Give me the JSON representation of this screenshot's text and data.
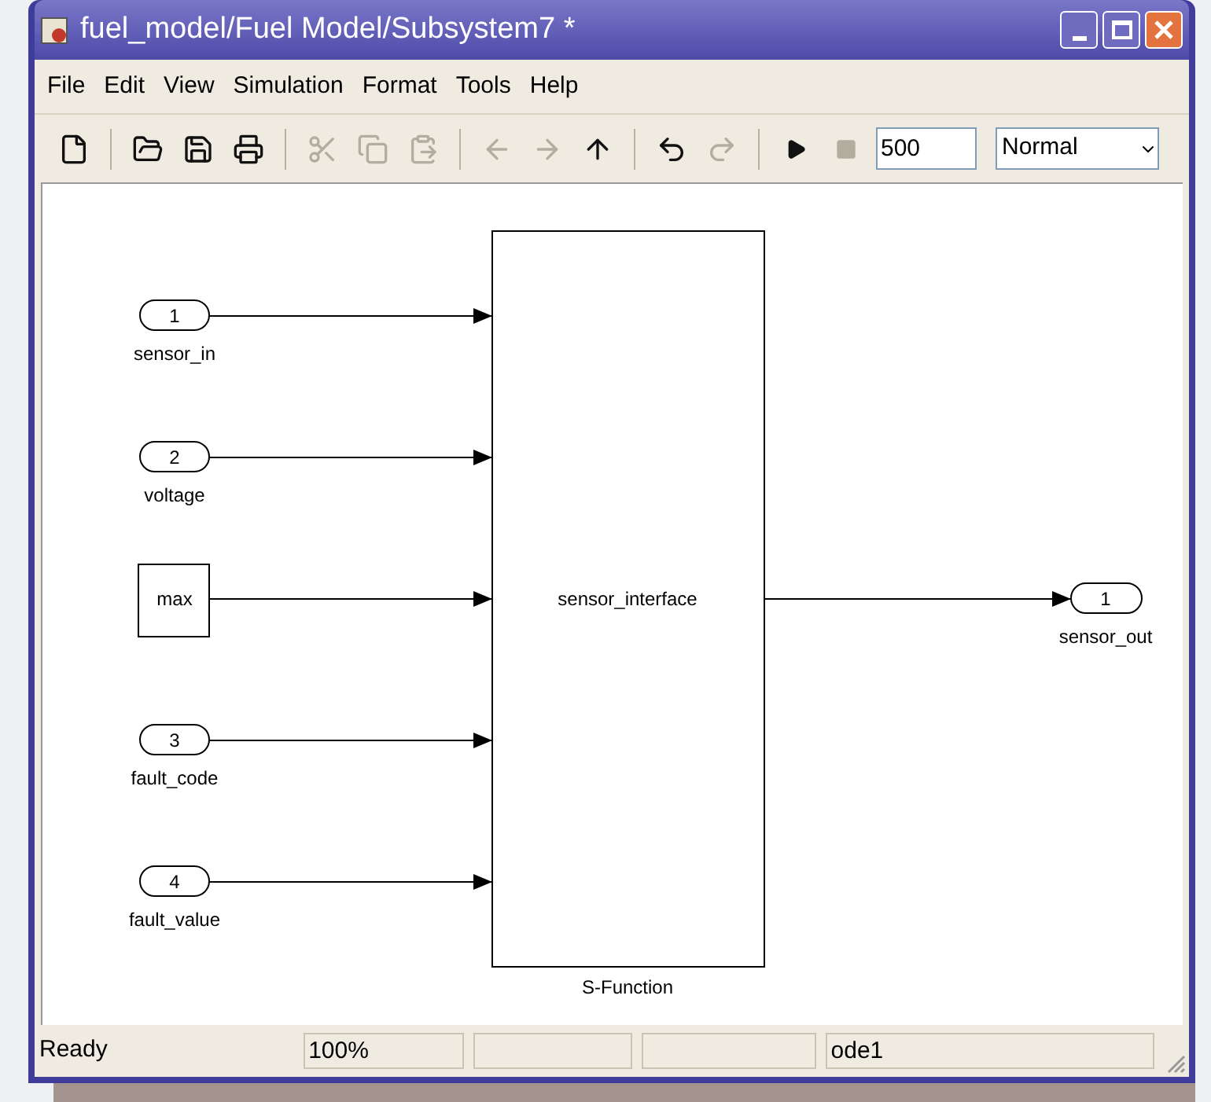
{
  "window": {
    "title": "fuel_model/Fuel Model/Subsystem7 *"
  },
  "menu": [
    "File",
    "Edit",
    "View",
    "Simulation",
    "Format",
    "Tools",
    "Help"
  ],
  "toolbar": [
    {
      "kind": "new",
      "disabled": false
    },
    {
      "kind": "sep"
    },
    {
      "kind": "open",
      "disabled": false
    },
    {
      "kind": "save",
      "disabled": false
    },
    {
      "kind": "print",
      "disabled": false
    },
    {
      "kind": "sep"
    },
    {
      "kind": "cut",
      "disabled": true
    },
    {
      "kind": "copy",
      "disabled": true
    },
    {
      "kind": "paste",
      "disabled": true
    },
    {
      "kind": "sep"
    },
    {
      "kind": "back",
      "disabled": true
    },
    {
      "kind": "forward",
      "disabled": true
    },
    {
      "kind": "up",
      "disabled": false
    },
    {
      "kind": "sep"
    },
    {
      "kind": "undo",
      "disabled": false
    },
    {
      "kind": "redo",
      "disabled": true
    },
    {
      "kind": "sep"
    },
    {
      "kind": "play",
      "disabled": false
    },
    {
      "kind": "stop",
      "disabled": true
    }
  ],
  "stop_time": "500",
  "sim_mode": "Normal",
  "diagram": {
    "inputs": [
      {
        "kind": "inport",
        "text": "1",
        "label": "sensor_in"
      },
      {
        "kind": "inport",
        "text": "2",
        "label": "voltage"
      },
      {
        "kind": "constant",
        "text": "max"
      },
      {
        "kind": "inport",
        "text": "3",
        "label": "fault_code"
      },
      {
        "kind": "inport",
        "text": "4",
        "label": "fault_value"
      }
    ],
    "block": {
      "text": "sensor_interface",
      "label": "S-Function"
    },
    "output": {
      "text": "1",
      "label": "sensor_out"
    }
  },
  "status_bar": {
    "message": "Ready",
    "panels": [
      {
        "kind": "text",
        "text": "100%"
      },
      {
        "kind": "empty"
      },
      {
        "kind": "empty"
      },
      {
        "kind": "text",
        "text": "ode1"
      }
    ]
  }
}
